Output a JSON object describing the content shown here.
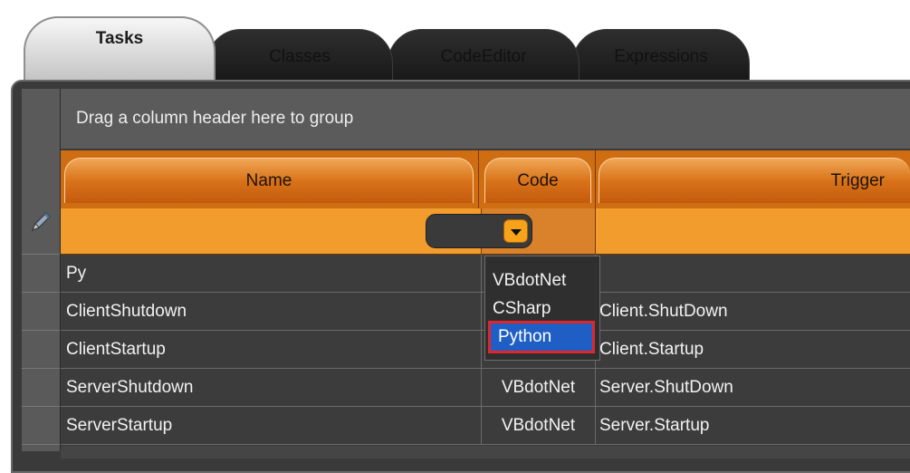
{
  "tabs": [
    {
      "label": "Tasks",
      "active": true
    },
    {
      "label": "Classes",
      "active": false
    },
    {
      "label": "CodeEditor",
      "active": false
    },
    {
      "label": "Expressions",
      "active": false
    }
  ],
  "group_panel": {
    "text": "Drag a column header here to group"
  },
  "columns": {
    "name": "Name",
    "code": "Code",
    "trigger": "Trigger"
  },
  "edit_row": {
    "icon": "pencil-icon",
    "combo_value": ""
  },
  "rows": [
    {
      "name": "Py",
      "code": "",
      "trigger": ""
    },
    {
      "name": "ClientShutdown",
      "code": "",
      "trigger": "Client.ShutDown"
    },
    {
      "name": "ClientStartup",
      "code": "",
      "trigger": "Client.Startup"
    },
    {
      "name": "ServerShutdown",
      "code": "VBdotNet",
      "trigger": "Server.ShutDown"
    },
    {
      "name": "ServerStartup",
      "code": "VBdotNet",
      "trigger": "Server.Startup"
    }
  ],
  "dropdown": {
    "options": [
      "VBdotNet",
      "CSharp",
      "Python"
    ],
    "selected": "Python"
  },
  "colors": {
    "accent_orange": "#cf6d12",
    "edit_row": "#f19c2c",
    "selection_blue": "#1f5fc5",
    "highlight_red": "#e0262a"
  }
}
